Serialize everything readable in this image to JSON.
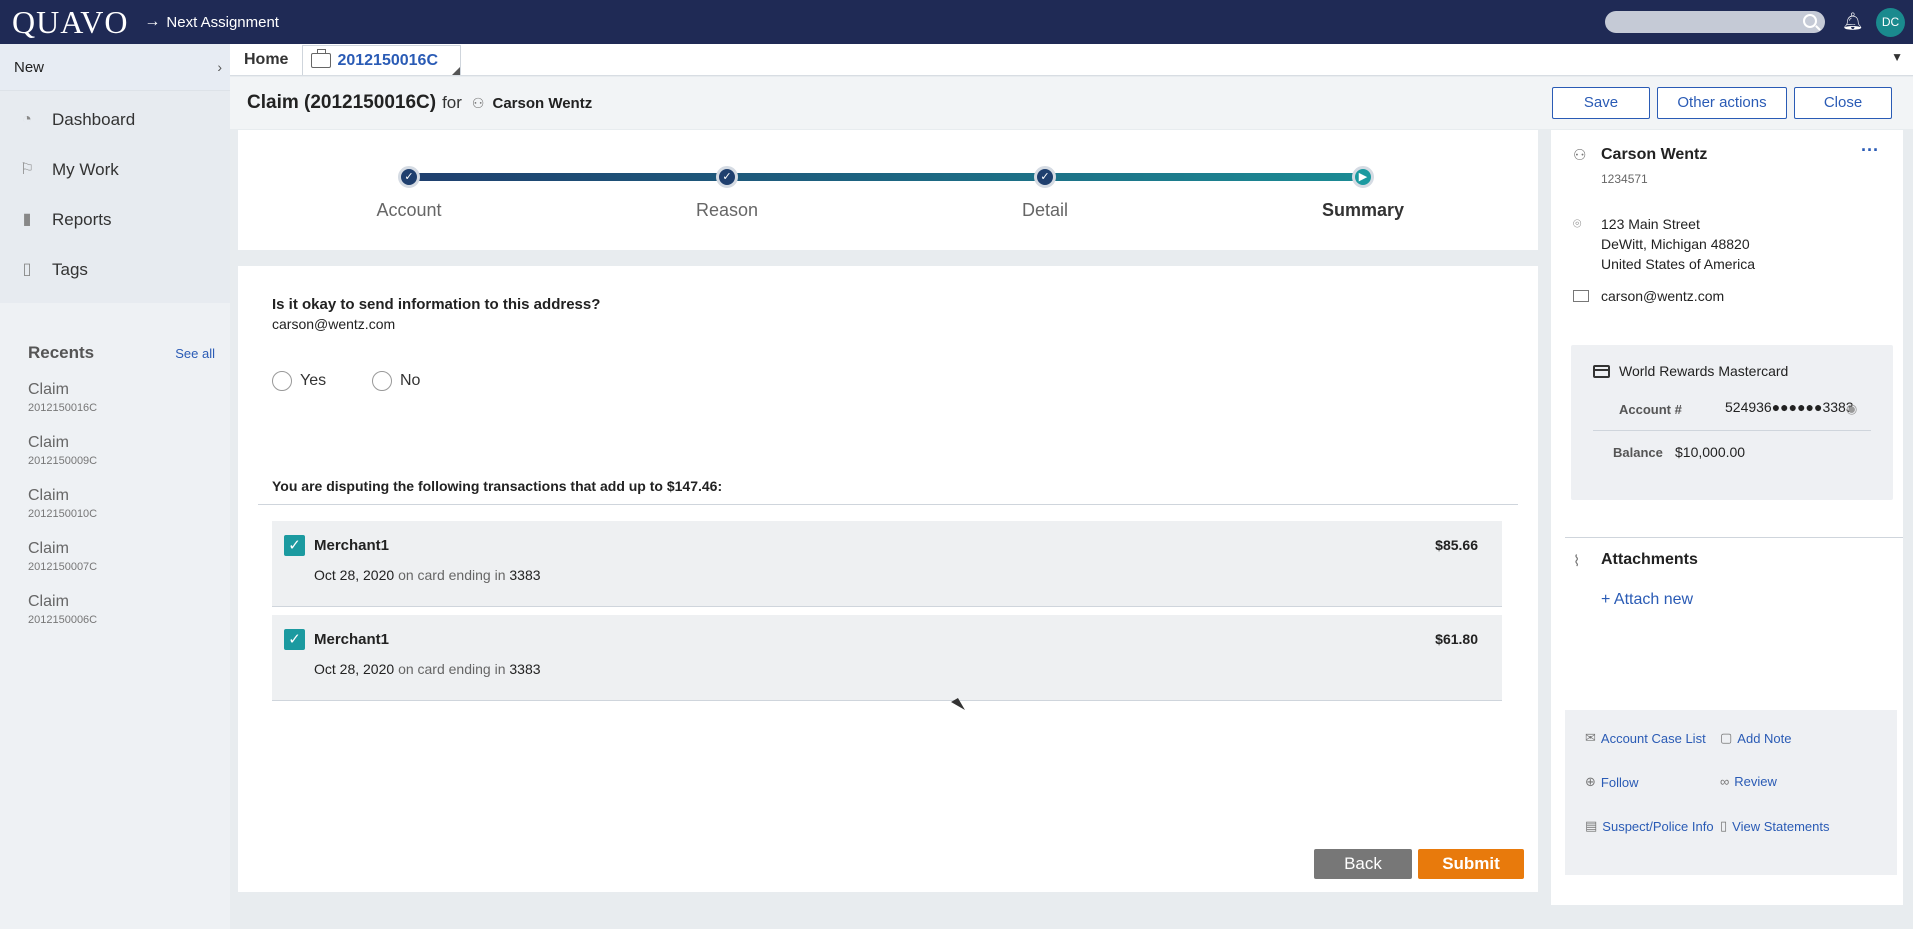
{
  "topbar": {
    "logo": "QUAVO",
    "next_assignment": "Next Assignment",
    "search_placeholder": "",
    "avatar_initials": "DC"
  },
  "sidebar": {
    "new_label": "New",
    "items": [
      {
        "label": "Dashboard",
        "icon": "dashboard-icon"
      },
      {
        "label": "My Work",
        "icon": "flag-icon"
      },
      {
        "label": "Reports",
        "icon": "bar-chart-icon"
      },
      {
        "label": "Tags",
        "icon": "tag-icon"
      }
    ],
    "recents_title": "Recents",
    "see_all": "See all",
    "recents": [
      {
        "name": "Claim",
        "id": "2012150016C"
      },
      {
        "name": "Claim",
        "id": "2012150009C"
      },
      {
        "name": "Claim",
        "id": "2012150010C"
      },
      {
        "name": "Claim",
        "id": "2012150007C"
      },
      {
        "name": "Claim",
        "id": "2012150006C"
      }
    ]
  },
  "tabs": {
    "home": "Home",
    "claim": "2012150016C"
  },
  "header": {
    "title": "Claim (2012150016C)",
    "for": "for",
    "person": "Carson Wentz",
    "save": "Save",
    "other_actions": "Other actions",
    "close": "Close"
  },
  "stepper": {
    "steps": [
      "Account",
      "Reason",
      "Detail",
      "Summary"
    ],
    "current_step": "Summary"
  },
  "form": {
    "question": "Is it okay to send information to this address?",
    "email": "carson@wentz.com",
    "yes": "Yes",
    "no": "No",
    "dispute_text": "You are disputing the following transactions that add up to $147.46:",
    "transactions": [
      {
        "merchant": "Merchant1",
        "amount": "$85.66",
        "date": "Oct 28, 2020",
        "card_text": "on card ending in",
        "card": "3383",
        "checked": true
      },
      {
        "merchant": "Merchant1",
        "amount": "$61.80",
        "date": "Oct 28, 2020",
        "card_text": "on card ending in",
        "card": "3383",
        "checked": true
      }
    ],
    "back": "Back",
    "submit": "Submit"
  },
  "customer": {
    "name": "Carson Wentz",
    "id": "1234571",
    "address_line1": "123 Main Street",
    "address_line2": "DeWitt, Michigan 48820",
    "address_line3": "United States of America",
    "email": "carson@wentz.com",
    "card_name": "World Rewards Mastercard",
    "account_label": "Account #",
    "account_number": "524936●●●●●●3383",
    "balance_label": "Balance",
    "balance": "$10,000.00"
  },
  "attachments": {
    "title": "Attachments",
    "attach_new": "Attach new"
  },
  "actions": [
    {
      "label": "Account Case List",
      "icon": "case-list-icon"
    },
    {
      "label": "Add Note",
      "icon": "note-icon"
    },
    {
      "label": "Follow",
      "icon": "follow-icon"
    },
    {
      "label": "Review",
      "icon": "glasses-icon"
    },
    {
      "label": "Suspect/Police Info",
      "icon": "clipboard-icon"
    },
    {
      "label": "View Statements",
      "icon": "document-icon"
    }
  ],
  "colors": {
    "topbar": "#1f2a55",
    "accent": "#1b9aa0",
    "link": "#2a5bb5",
    "submit": "#e87a0c"
  }
}
